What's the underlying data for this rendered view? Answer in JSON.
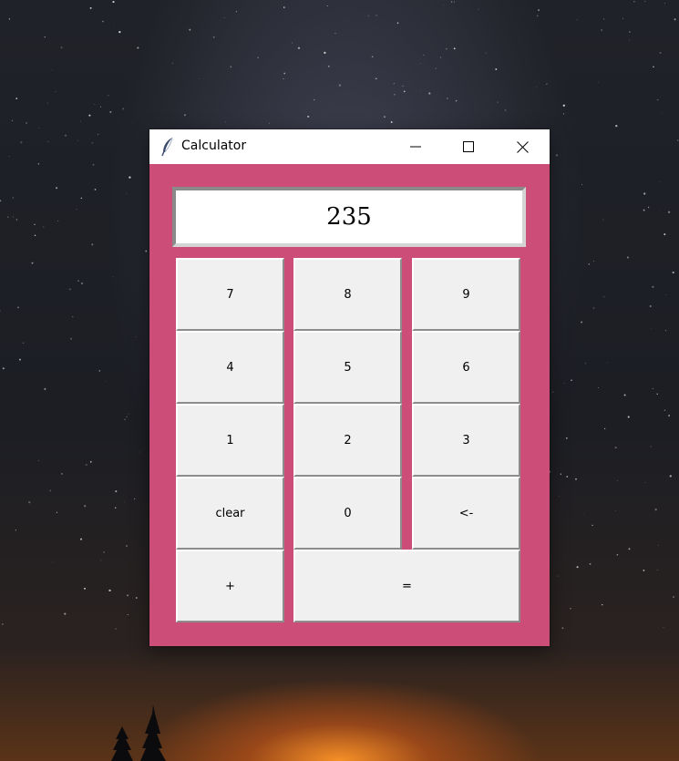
{
  "window": {
    "title": "Calculator",
    "background_color": "#cd4d79",
    "controls": [
      "minimize-icon",
      "maximize-icon",
      "close-icon"
    ]
  },
  "display": {
    "value": "235"
  },
  "keys": {
    "k7": "7",
    "k8": "8",
    "k9": "9",
    "k4": "4",
    "k5": "5",
    "k6": "6",
    "k1": "1",
    "k2": "2",
    "k3": "3",
    "clear": "clear",
    "k0": "0",
    "back": "<-",
    "plus": "+",
    "equals": "="
  }
}
